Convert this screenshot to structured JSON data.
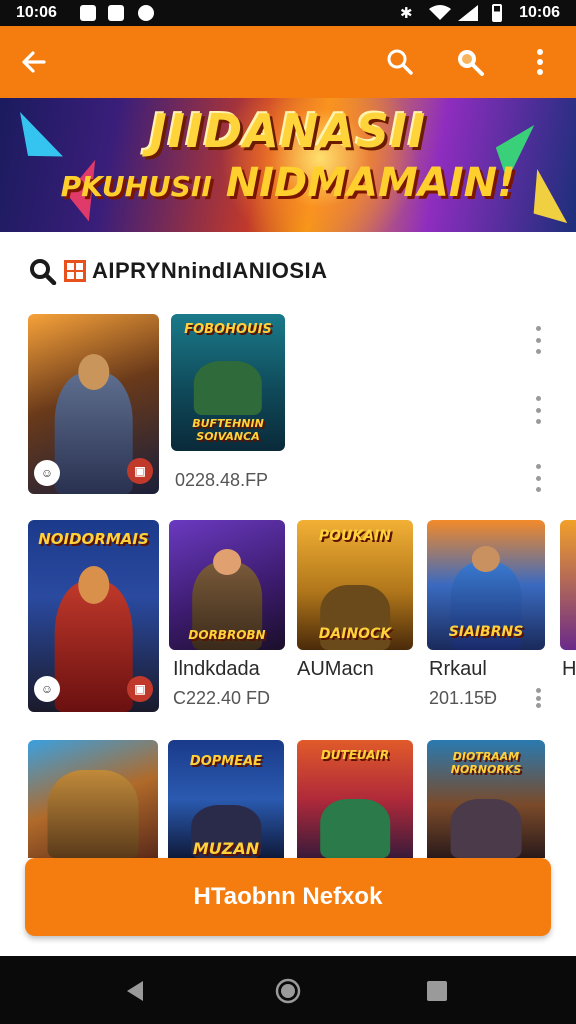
{
  "status_bar": {
    "time_left": "10:06",
    "time_right": "10:06"
  },
  "toolbar": {
    "back_icon": "arrow-left-icon",
    "search_icon": "search-icon",
    "search2_icon": "search-icon",
    "menu_icon": "more-vert-icon",
    "bg": "#f57c0f"
  },
  "banner": {
    "line1": "JIIDANASII",
    "line2_small": "PKUHUSII",
    "line2": "NIDMAMAIN!"
  },
  "section": {
    "title": "AIPRYNnindIANIOSIA"
  },
  "row1": [
    {
      "logo": "",
      "label": "",
      "sub": ""
    },
    {
      "logo": "FOBOHOUIS",
      "logo2": "BUFTEHNIN SOIVANCA",
      "label": "",
      "sub": "0228.48.FP"
    }
  ],
  "row2": [
    {
      "logo": "NOIDORMAIS",
      "label": "",
      "sub": ""
    },
    {
      "logo": "DORBROBN",
      "label": "Ilndkdada",
      "sub": "C222.40 FD"
    },
    {
      "logo": "POUKAIN",
      "logo2": "DAINOCK",
      "label": "AUMacn",
      "sub": ""
    },
    {
      "logo": "SIAIBRNS",
      "label": "Rrkaul",
      "sub": "201.15Ð"
    },
    {
      "logo": "",
      "label": "H",
      "sub": ""
    }
  ],
  "row3": [
    {
      "logo": ""
    },
    {
      "logo": "DOPMEAE",
      "logo2": "MUZAN"
    },
    {
      "logo": "DUTEUAIR"
    },
    {
      "logo": "DIOTRAAM NORNORKS"
    }
  ],
  "cta": {
    "label": "HTaobnn Nefxok",
    "bg": "#f57c0f"
  },
  "nav": {
    "back": "back-icon",
    "home": "home-icon",
    "recents": "recents-icon"
  }
}
